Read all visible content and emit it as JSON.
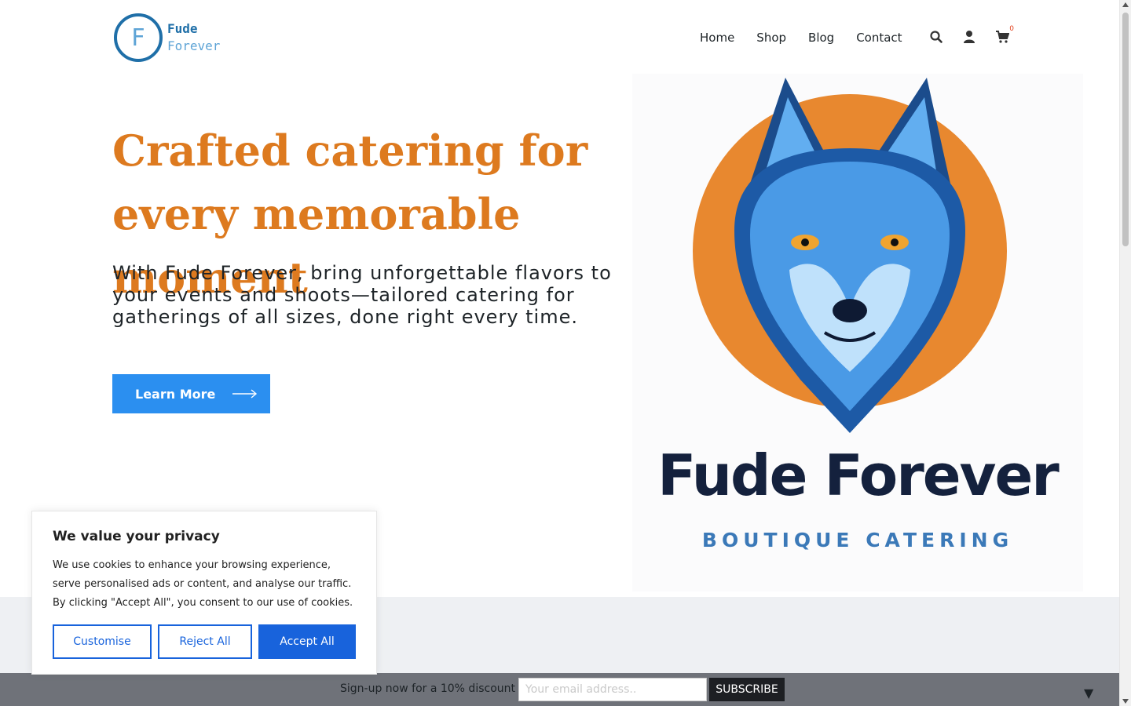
{
  "header": {
    "logo": {
      "letter": "F",
      "line1": "Fude",
      "line2": "Forever"
    },
    "nav": [
      "Home",
      "Shop",
      "Blog",
      "Contact"
    ],
    "cart_count": "0"
  },
  "hero": {
    "title": "Crafted catering for every memorable moment",
    "subtitle": "With Fude Forever, bring unforgettable flavors to your events and shoots—tailored catering for gatherings of all sizes, done right every time.",
    "button_label": "Learn More",
    "image": {
      "name": "Fude Forever",
      "tagline": "BOUTIQUE CATERING"
    }
  },
  "cookie": {
    "title": "We value your privacy",
    "text": "We use cookies to enhance your browsing experience, serve personalised ads or content, and analyse our traffic. By clicking \"Accept All\", you consent to our use of cookies.",
    "customise": "Customise",
    "reject": "Reject All",
    "accept": "Accept All"
  },
  "signup": {
    "text": "Sign-up now for a 10% discount",
    "placeholder": "Your email address..",
    "button": "SUBSCRIBE",
    "toggle": "▼"
  },
  "colors": {
    "accent_orange": "#dd7a1f",
    "button_blue": "#2b8ff0",
    "cookie_blue": "#1863dc"
  }
}
